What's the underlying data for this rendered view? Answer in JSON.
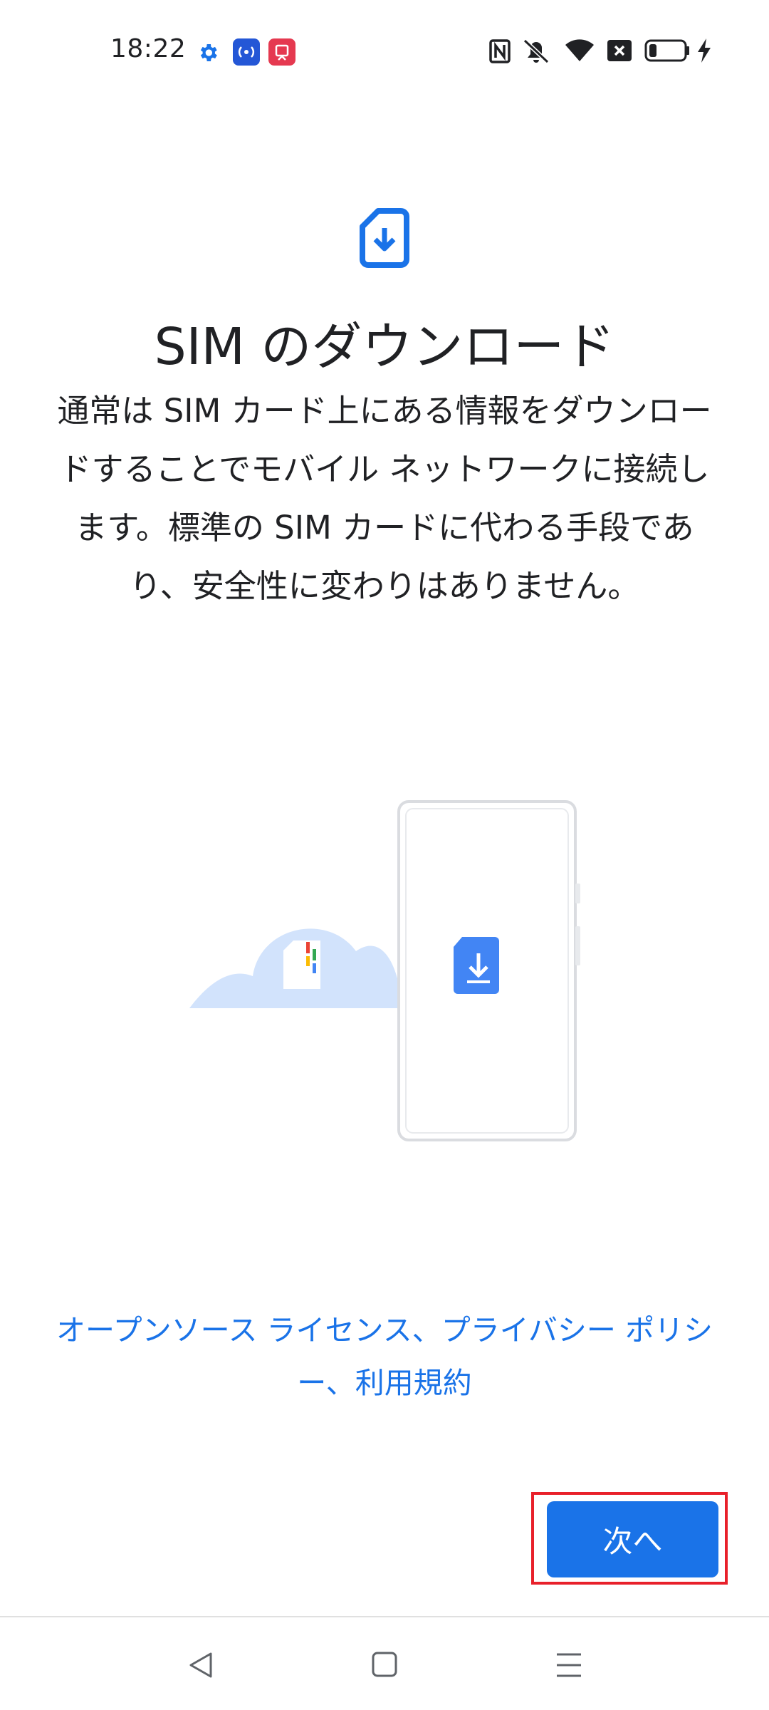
{
  "status_bar": {
    "time": "18:22",
    "left_icons": [
      "settings-gear-icon",
      "broadcast-icon",
      "screen-record-icon"
    ],
    "right_icons": [
      "nfc-icon",
      "vibrate-off-icon",
      "wifi-icon",
      "no-sim-icon",
      "battery-low-icon",
      "charging-bolt-icon"
    ]
  },
  "page": {
    "title": "SIM のダウンロード",
    "description": "通常は SIM カード上にある情報をダウンロードすることでモバイル ネットワークに接続します。標準の SIM カードに代わる手段であり、安全性に変わりはありません。"
  },
  "legal": {
    "open_source": "オープンソース ライセンス",
    "separator1": "、",
    "privacy": "プライバシー ポリシー",
    "separator2": "、",
    "terms": "利用規約"
  },
  "actions": {
    "next_label": "次へ"
  },
  "nav": {
    "buttons": [
      "back-icon",
      "home-icon",
      "recents-menu-icon"
    ]
  },
  "colors": {
    "accent": "#1a73e8",
    "highlight": "#e8202a",
    "cloud": "#d2e3fc"
  }
}
